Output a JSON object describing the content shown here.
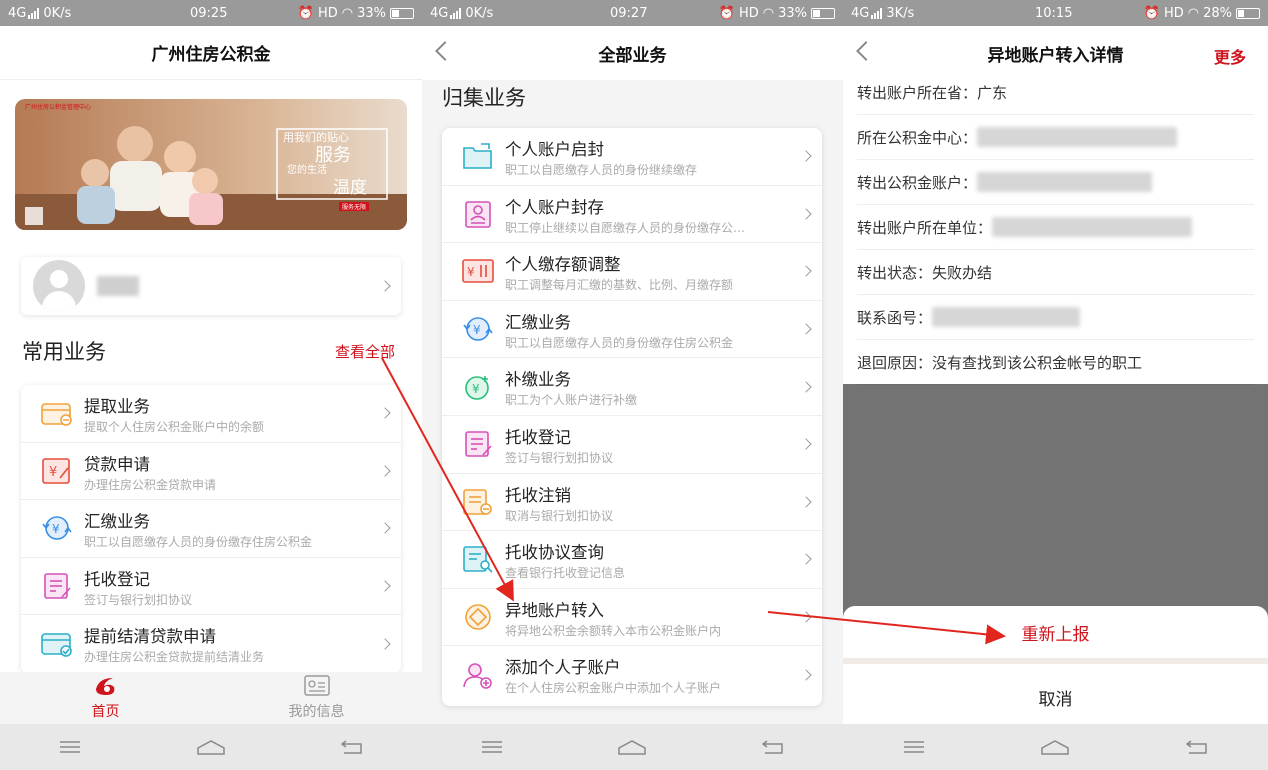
{
  "panel1": {
    "status": {
      "network": "4G",
      "speed": "0K/s",
      "time": "09:25",
      "hd": "HD",
      "battery": "33%",
      "battery_fill": 0.33
    },
    "title": "广州住房公积金",
    "banner": {
      "brand": "广州住房公积金管理中心",
      "slogan1": "用我们的贴心",
      "slogan2": "服务",
      "slogan3": "温暖",
      "slogan4": "您的生活",
      "slogan5": "温度",
      "tag": "服务无限"
    },
    "section_title": "常用业务",
    "see_all": "查看全部",
    "items": [
      {
        "title": "提取业务",
        "desc": "提取个人住房公积金账户中的余额",
        "icon": "wallet-icon",
        "color": "#f0a23a"
      },
      {
        "title": "贷款申请",
        "desc": "办理住房公积金贷款申请",
        "icon": "loan-icon",
        "color": "#e74c3c"
      },
      {
        "title": "汇缴业务",
        "desc": "职工以自愿缴存人员的身份缴存住房公积金",
        "icon": "remit-icon",
        "color": "#3a8ee6"
      },
      {
        "title": "托收登记",
        "desc": "签订与银行划扣协议",
        "icon": "register-icon",
        "color": "#d651b8"
      },
      {
        "title": "提前结清贷款申请",
        "desc": "办理住房公积金贷款提前结清业务",
        "icon": "card-check-icon",
        "color": "#2ab0c8"
      }
    ],
    "tabs": [
      {
        "label": "首页",
        "icon": "home-logo-icon"
      },
      {
        "label": "我的信息",
        "icon": "profile-card-icon"
      }
    ]
  },
  "panel2": {
    "status": {
      "network": "4G",
      "speed": "0K/s",
      "time": "09:27",
      "hd": "HD",
      "battery": "33%",
      "battery_fill": 0.33
    },
    "title": "全部业务",
    "section_title": "归集业务",
    "items": [
      {
        "title": "个人账户启封",
        "desc": "职工以自愿缴存人员的身份继续缴存",
        "icon": "folder-open-icon",
        "color": "#2ab0c8"
      },
      {
        "title": "个人账户封存",
        "desc": "职工停止继续以自愿缴存人员的身份缴存公…",
        "icon": "person-seal-icon",
        "color": "#d651b8"
      },
      {
        "title": "个人缴存额调整",
        "desc": "职工调整每月汇缴的基数、比例、月缴存额",
        "icon": "adjust-icon",
        "color": "#e74c3c"
      },
      {
        "title": "汇缴业务",
        "desc": "职工以自愿缴存人员的身份缴存住房公积金",
        "icon": "remit-icon",
        "color": "#3a8ee6"
      },
      {
        "title": "补缴业务",
        "desc": "职工为个人账户进行补缴",
        "icon": "supplement-icon",
        "color": "#27c07a"
      },
      {
        "title": "托收登记",
        "desc": "签订与银行划扣协议",
        "icon": "register-icon",
        "color": "#d651b8"
      },
      {
        "title": "托收注销",
        "desc": "取消与银行划扣协议",
        "icon": "cancel-doc-icon",
        "color": "#f0a23a"
      },
      {
        "title": "托收协议查询",
        "desc": "查看银行托收登记信息",
        "icon": "search-doc-icon",
        "color": "#2ab0c8"
      },
      {
        "title": "异地账户转入",
        "desc": "将异地公积金余额转入本市公积金账户内",
        "icon": "transfer-icon",
        "color": "#f0a23a"
      },
      {
        "title": "添加个人子账户",
        "desc": "在个人住房公积金账户中添加个人子账户",
        "icon": "add-user-icon",
        "color": "#d651b8"
      }
    ]
  },
  "panel3": {
    "status": {
      "network": "4G",
      "speed": "3K/s",
      "time": "10:15",
      "hd": "HD",
      "battery": "28%",
      "battery_fill": 0.28
    },
    "title": "异地账户转入详情",
    "more": "更多",
    "details": [
      {
        "label": "转出账户所在省：",
        "value": "广东"
      },
      {
        "label": "所在公积金中心：",
        "value": ""
      },
      {
        "label": "转出公积金账户：",
        "value": ""
      },
      {
        "label": "转出账户所在单位：",
        "value": ""
      },
      {
        "label": "转出状态：",
        "value": "失败办结"
      },
      {
        "label": "联系函号：",
        "value": ""
      },
      {
        "label": "退回原因：",
        "value": "没有查找到该公积金帐号的职工"
      }
    ],
    "sheet": {
      "resubmit": "重新上报",
      "cancel": "取消"
    }
  },
  "colors": {
    "accent": "#d0121b",
    "arrow": "#e0261e"
  }
}
